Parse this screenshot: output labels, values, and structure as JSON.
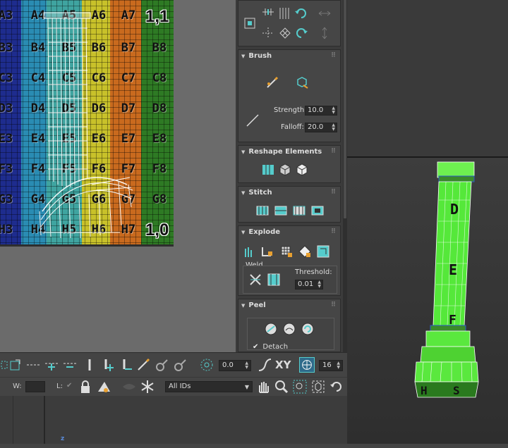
{
  "uv_canvas": {
    "rows": [
      [
        "A3",
        "A4",
        "A5",
        "A6",
        "A7"
      ],
      [
        "B3",
        "B4",
        "B5",
        "B6",
        "B7",
        "B8"
      ],
      [
        "C3",
        "C4",
        "C5",
        "C6",
        "C7",
        "C8"
      ],
      [
        "D3",
        "D4",
        "D5",
        "D6",
        "D7",
        "D8"
      ],
      [
        "E3",
        "E4",
        "E5",
        "E6",
        "E7",
        "E8"
      ],
      [
        "F3",
        "F4",
        "F5",
        "F6",
        "F7",
        "F8"
      ],
      [
        "G3",
        "G4",
        "G5",
        "G6",
        "G7",
        "G8"
      ],
      [
        "H3",
        "H4",
        "H5",
        "H6",
        "H7"
      ]
    ],
    "corner_top": "1,1",
    "corner_bottom": "1,0",
    "column_colors": [
      "#1e2c8e",
      "#2a8cb3",
      "#3fa4a0",
      "#6cb42e",
      "#d0c026",
      "#c96a1e",
      "#2e7a24"
    ]
  },
  "panel": {
    "brush": {
      "title": "Brush",
      "strength_label": "Strength:",
      "strength_value": "10.0",
      "falloff_label": "Falloff:",
      "falloff_value": "20.0"
    },
    "reshape": {
      "title": "Reshape Elements"
    },
    "stitch": {
      "title": "Stitch"
    },
    "explode": {
      "title": "Explode",
      "weld_label": "Weld",
      "threshold_label": "Threshold:",
      "threshold_value": "0.01"
    },
    "peel": {
      "title": "Peel",
      "detach_label": "Detach"
    }
  },
  "toolbar": {
    "angle_value": "0.0",
    "xy_label": "XY",
    "snap_value": "16",
    "w_label": "W:",
    "l_label": "L:",
    "ids_select": "All IDs"
  },
  "viewport": {
    "axis_label": "z"
  }
}
